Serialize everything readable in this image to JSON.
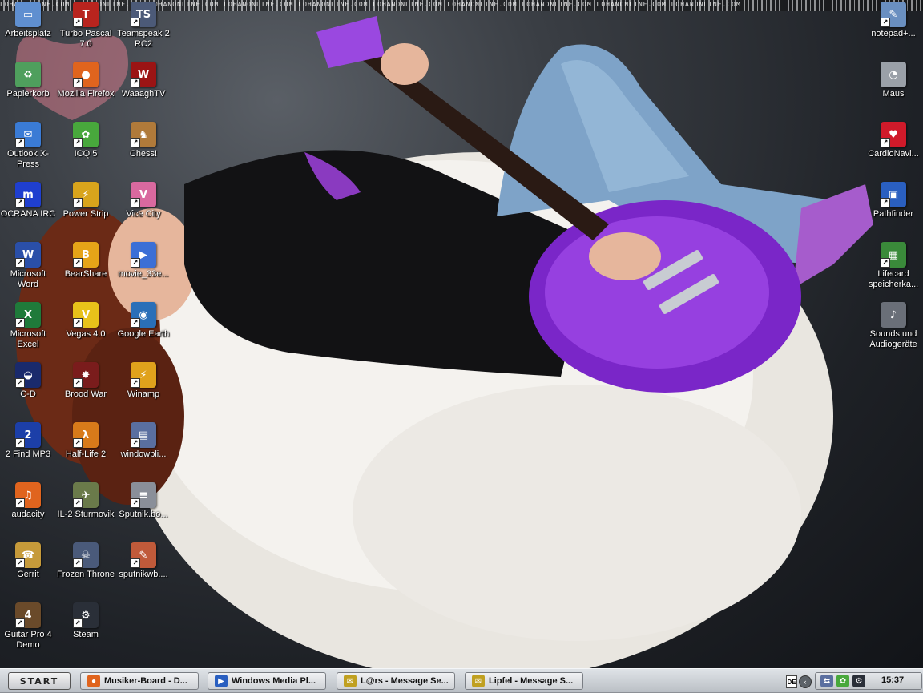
{
  "wallpaper": {
    "banner_text": "LOHANONLINE.COM LOHANONLINE.COM LOHANONLINE.COM LOHANONLINE.COM LOHANONLINE.COM LOHANONLINE.COM LOHANONLINE.COM LOHANONLINE.COM LOHANONLINE.COM LOHANONLINE.COM"
  },
  "desktop": {
    "icons": [
      {
        "id": "arbeitsplatz",
        "label": "Arbeitsplatz",
        "icon": "computer-icon",
        "color": "#5f8fd0"
      },
      {
        "id": "turbo-pascal",
        "label": "Turbo Pascal 7.0",
        "icon": "turbo-pascal-icon",
        "color": "#b8241e"
      },
      {
        "id": "teamspeak",
        "label": "Teamspeak 2 RC2",
        "icon": "teamspeak-icon",
        "color": "#4c5a78"
      },
      {
        "id": "papierkorb",
        "label": "Papierkorb",
        "icon": "recycle-bin-icon",
        "color": "#4f9f5d"
      },
      {
        "id": "firefox",
        "label": "Mozilla Firefox",
        "icon": "firefox-icon",
        "color": "#e0641e"
      },
      {
        "id": "waaaghtv",
        "label": "WaaaghTV",
        "icon": "waaaghtv-icon",
        "color": "#9b1414"
      },
      {
        "id": "outlook-xpress",
        "label": "Outlook X-Press",
        "icon": "outlook-icon",
        "color": "#3a7bd5"
      },
      {
        "id": "icq",
        "label": "ICQ 5",
        "icon": "icq-flower-icon",
        "color": "#48a83c"
      },
      {
        "id": "chess",
        "label": "Chess!",
        "icon": "chess-icon",
        "color": "#b07a3a"
      },
      {
        "id": "ocrana",
        "label": "OCRANA IRC",
        "icon": "ocrana-irc-icon",
        "color": "#1f3fcf"
      },
      {
        "id": "power-strip",
        "label": "Power Strip",
        "icon": "power-strip-icon",
        "color": "#d8a41c"
      },
      {
        "id": "vice-city",
        "label": "Vice City",
        "icon": "vice-city-icon",
        "color": "#d9699f"
      },
      {
        "id": "word",
        "label": "Microsoft Word",
        "icon": "word-icon",
        "color": "#2a4fa8"
      },
      {
        "id": "bearshare",
        "label": "BearShare",
        "icon": "bearshare-icon",
        "color": "#e6a418"
      },
      {
        "id": "movie",
        "label": "movie_33e...",
        "icon": "media-file-icon",
        "color": "#3b6fd6"
      },
      {
        "id": "excel",
        "label": "Microsoft Excel",
        "icon": "excel-icon",
        "color": "#1f7a3a"
      },
      {
        "id": "vegas",
        "label": "Vegas 4.0",
        "icon": "vegas-icon",
        "color": "#e8c21a"
      },
      {
        "id": "google-earth",
        "label": "Google Earth",
        "icon": "google-earth-icon",
        "color": "#2a6fb8"
      },
      {
        "id": "c-d",
        "label": "C-D",
        "icon": "c-d-icon",
        "color": "#1a2a6c"
      },
      {
        "id": "brood-war",
        "label": "Brood War",
        "icon": "brood-war-icon",
        "color": "#7a1c1c"
      },
      {
        "id": "winamp",
        "label": "Winamp",
        "icon": "winamp-icon",
        "color": "#e0a21c"
      },
      {
        "id": "2find-mp3",
        "label": "2 Find MP3",
        "icon": "2find-mp3-icon",
        "color": "#1c3fa8"
      },
      {
        "id": "half-life-2",
        "label": "Half-Life 2",
        "icon": "half-life-icon",
        "color": "#d87a1a"
      },
      {
        "id": "windowblinds",
        "label": "windowbli...",
        "icon": "windowblinds-icon",
        "color": "#5a6fa0"
      },
      {
        "id": "audacity",
        "label": "audacity",
        "icon": "audacity-icon",
        "color": "#e0641e"
      },
      {
        "id": "il2",
        "label": "IL-2 Sturmovik",
        "icon": "il2-icon",
        "color": "#6a7a4a"
      },
      {
        "id": "sputnik-bo",
        "label": "Sputnik.bo...",
        "icon": "text-file-icon",
        "color": "#8a8f99"
      },
      {
        "id": "gerrit",
        "label": "Gerrit",
        "icon": "phone-icon",
        "color": "#c69a3a"
      },
      {
        "id": "frozen-throne",
        "label": "Frozen Throne",
        "icon": "frozen-throne-icon",
        "color": "#4a5a7a"
      },
      {
        "id": "sputnikwb",
        "label": "sputnikwb....",
        "icon": "script-file-icon",
        "color": "#c05a3a"
      },
      {
        "id": "guitar-pro",
        "label": "Guitar Pro 4 Demo",
        "icon": "guitar-pro-icon",
        "color": "#6a4a2a"
      },
      {
        "id": "steam",
        "label": "Steam",
        "icon": "steam-icon",
        "color": "#2a2f38"
      },
      {
        "id": "notepad",
        "label": "notepad+...",
        "icon": "notepad-icon",
        "color": "#6a8fc0"
      },
      {
        "id": "maus",
        "label": "Maus",
        "icon": "mouse-icon",
        "color": "#9aa0a8"
      },
      {
        "id": "cardionavi",
        "label": "CardioNavi...",
        "icon": "heart-icon",
        "color": "#d01a2a"
      },
      {
        "id": "pathfinder",
        "label": "Pathfinder",
        "icon": "pathfinder-icon",
        "color": "#2a5fc0"
      },
      {
        "id": "lifecard",
        "label": "Lifecard speicherka...",
        "icon": "memory-card-icon",
        "color": "#3a8a3a"
      },
      {
        "id": "sounds",
        "label": "Sounds und Audiogeräte",
        "icon": "speaker-icon",
        "color": "#6a6f78"
      }
    ]
  },
  "taskbar": {
    "start_label": "START",
    "tasks": [
      {
        "label": "Musiker-Board - D...",
        "icon": "firefox-icon",
        "color": "#e0641e"
      },
      {
        "label": "Windows Media Pl...",
        "icon": "media-player-icon",
        "color": "#2a5fc0"
      },
      {
        "label": "L@rs - Message Se...",
        "icon": "message-session-icon",
        "color": "#c0a020"
      },
      {
        "label": "Lipfel - Message S...",
        "icon": "message-session-icon",
        "color": "#c0a020"
      }
    ],
    "language": "DE",
    "tray_icons": [
      {
        "name": "network-icon",
        "color": "#5a6fa0"
      },
      {
        "name": "icq-flower-icon",
        "color": "#48a83c"
      },
      {
        "name": "steam-icon",
        "color": "#2a2f38"
      }
    ],
    "clock": "15:37"
  }
}
